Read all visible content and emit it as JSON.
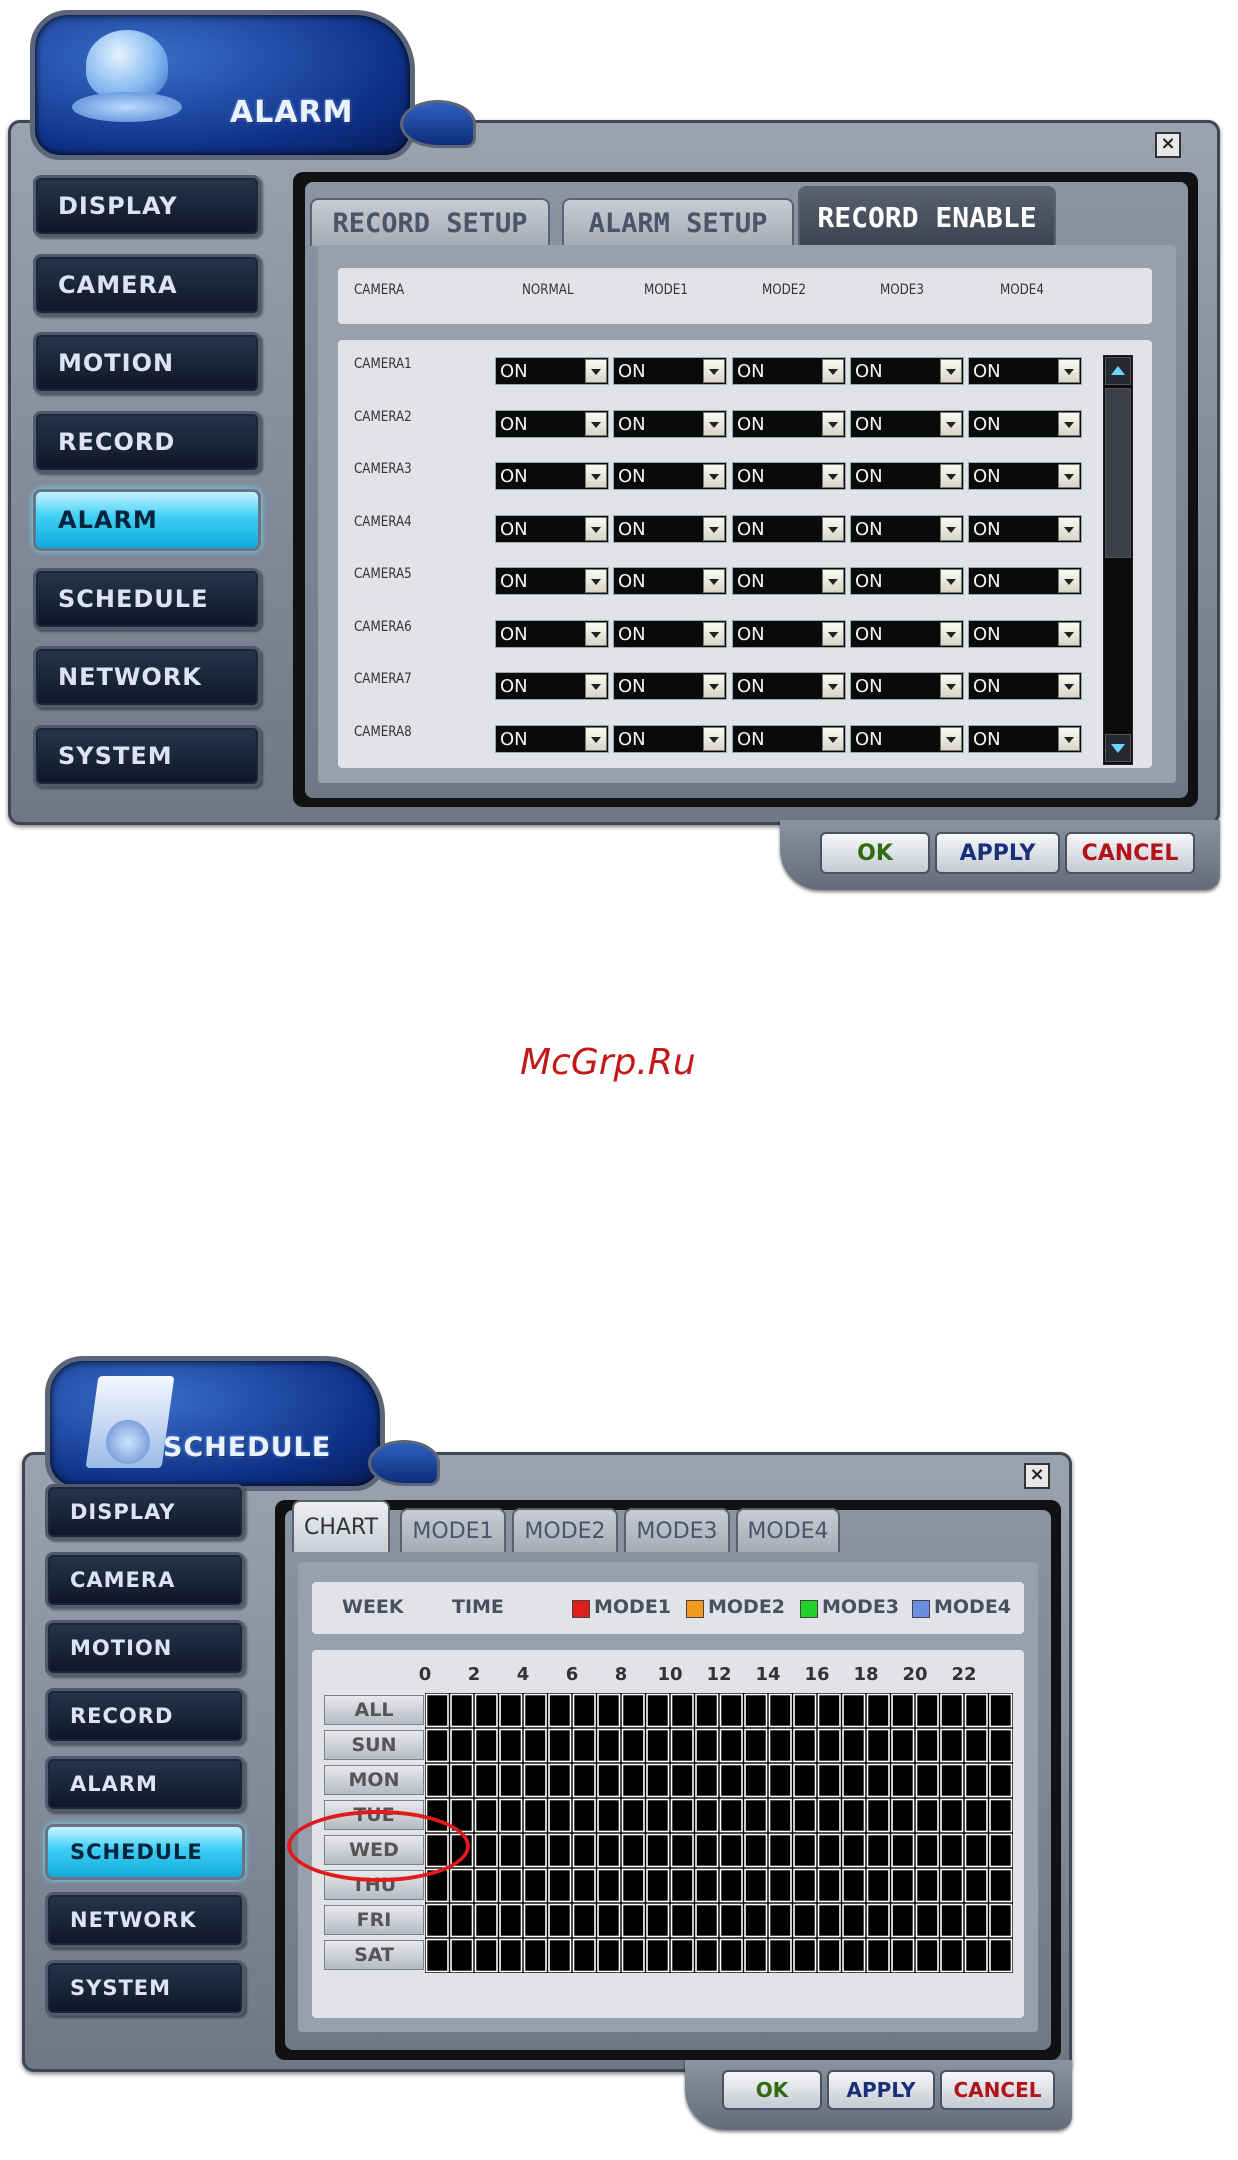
{
  "alarm_window": {
    "title": "ALARM",
    "nav": [
      "DISPLAY",
      "CAMERA",
      "MOTION",
      "RECORD",
      "ALARM",
      "SCHEDULE",
      "NETWORK",
      "SYSTEM"
    ],
    "active_nav": "ALARM",
    "tabs": [
      "RECORD SETUP",
      "ALARM SETUP",
      "RECORD ENABLE"
    ],
    "active_tab": "RECORD ENABLE",
    "columns": [
      "CAMERA",
      "NORMAL",
      "MODE1",
      "MODE2",
      "MODE3",
      "MODE4"
    ],
    "rows": [
      {
        "camera": "CAMERA1",
        "values": [
          "ON",
          "ON",
          "ON",
          "ON",
          "ON"
        ]
      },
      {
        "camera": "CAMERA2",
        "values": [
          "ON",
          "ON",
          "ON",
          "ON",
          "ON"
        ]
      },
      {
        "camera": "CAMERA3",
        "values": [
          "ON",
          "ON",
          "ON",
          "ON",
          "ON"
        ]
      },
      {
        "camera": "CAMERA4",
        "values": [
          "ON",
          "ON",
          "ON",
          "ON",
          "ON"
        ]
      },
      {
        "camera": "CAMERA5",
        "values": [
          "ON",
          "ON",
          "ON",
          "ON",
          "ON"
        ]
      },
      {
        "camera": "CAMERA6",
        "values": [
          "ON",
          "ON",
          "ON",
          "ON",
          "ON"
        ]
      },
      {
        "camera": "CAMERA7",
        "values": [
          "ON",
          "ON",
          "ON",
          "ON",
          "ON"
        ]
      },
      {
        "camera": "CAMERA8",
        "values": [
          "ON",
          "ON",
          "ON",
          "ON",
          "ON"
        ]
      }
    ],
    "buttons": {
      "ok": "OK",
      "apply": "APPLY",
      "cancel": "CANCEL"
    },
    "close_glyph": "×"
  },
  "watermark": "McGrp.Ru",
  "schedule_window": {
    "title": "SCHEDULE",
    "nav": [
      "DISPLAY",
      "CAMERA",
      "MOTION",
      "RECORD",
      "ALARM",
      "SCHEDULE",
      "NETWORK",
      "SYSTEM"
    ],
    "active_nav": "SCHEDULE",
    "tabs": [
      "CHART",
      "MODE1",
      "MODE2",
      "MODE3",
      "MODE4"
    ],
    "active_tab": "CHART",
    "header": {
      "week": "WEEK",
      "time": "TIME"
    },
    "legend": [
      {
        "label": "MODE1",
        "color": "#e01c1c"
      },
      {
        "label": "MODE2",
        "color": "#f29a1b"
      },
      {
        "label": "MODE3",
        "color": "#22d12a"
      },
      {
        "label": "MODE4",
        "color": "#6a8ee0"
      }
    ],
    "hours": [
      "0",
      "2",
      "4",
      "6",
      "8",
      "10",
      "12",
      "14",
      "16",
      "18",
      "20",
      "22"
    ],
    "days": [
      "ALL",
      "SUN",
      "MON",
      "TUE",
      "WED",
      "THU",
      "FRI",
      "SAT"
    ],
    "highlighted_day": "WED",
    "highlight_color": "#e11b1b",
    "buttons": {
      "ok": "OK",
      "apply": "APPLY",
      "cancel": "CANCEL"
    },
    "close_glyph": "×"
  },
  "colors": {
    "ok_text": "#2e6b11",
    "apply_text": "#1b2e7a",
    "cancel_text": "#b3121b",
    "watermark": "#c41818"
  }
}
